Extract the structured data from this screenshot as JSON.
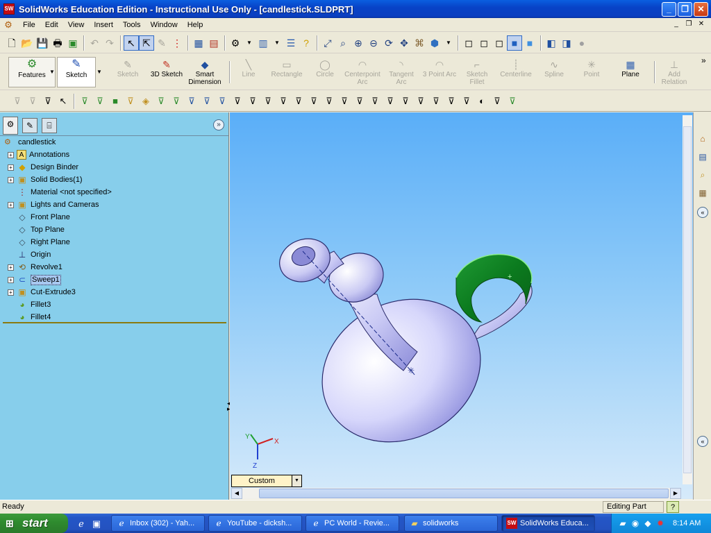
{
  "window": {
    "app_icon": "SW",
    "title": "SolidWorks Education Edition - Instructional Use Only - [candlestick.SLDPRT]",
    "buttons": {
      "minimize": "_",
      "restore": "❐",
      "close": "✕"
    }
  },
  "menu": {
    "items": [
      "File",
      "Edit",
      "View",
      "Insert",
      "Tools",
      "Window",
      "Help"
    ],
    "mdi_buttons": [
      "_",
      "❐",
      "✕"
    ]
  },
  "toolbar_standard": {
    "icons": [
      "new-icon",
      "open-icon",
      "save-icon",
      "print-icon",
      "print-preview-icon",
      "undo-icon",
      "redo-icon",
      "select-icon",
      "select-filter-icon",
      "sketch-rebuild-icon",
      "rebuild-traffic-light-icon",
      "grid-icon",
      "wall-icon",
      "options-icon",
      "layer-icon",
      "properties-icon",
      "help-icon",
      "zoom-to-fit-icon",
      "zoom-area-icon",
      "zoom-in-out-icon",
      "zoom-selection-icon",
      "rotate-icon",
      "pan-icon",
      "view-orientation-icon",
      "wireframe-icon",
      "hidden-lines-visible-icon",
      "hidden-lines-removed-icon",
      "shaded-with-edges-icon",
      "shaded-icon",
      "section-view-icon",
      "perspective-icon"
    ]
  },
  "command_manager": {
    "features_label": "Features",
    "sketch_label": "Sketch",
    "items": [
      {
        "label": "Sketch",
        "icon": "sketch-icon"
      },
      {
        "label": "3D Sketch",
        "icon": "3d-sketch-icon"
      },
      {
        "label": "Smart Dimension",
        "icon": "smart-dimension-icon"
      },
      {
        "label": "Line",
        "icon": "line-icon"
      },
      {
        "label": "Rectangle",
        "icon": "rectangle-icon"
      },
      {
        "label": "Circle",
        "icon": "circle-icon"
      },
      {
        "label": "Centerpoint Arc",
        "icon": "centerpoint-arc-icon"
      },
      {
        "label": "Tangent Arc",
        "icon": "tangent-arc-icon"
      },
      {
        "label": "3 Point Arc",
        "icon": "three-point-arc-icon"
      },
      {
        "label": "Sketch Fillet",
        "icon": "sketch-fillet-icon"
      },
      {
        "label": "Centerline",
        "icon": "centerline-icon"
      },
      {
        "label": "Spline",
        "icon": "spline-icon"
      },
      {
        "label": "Point",
        "icon": "point-icon"
      },
      {
        "label": "Plane",
        "icon": "plane-icon"
      },
      {
        "label": "Add Relation",
        "icon": "add-relation-icon"
      }
    ],
    "more": "»"
  },
  "feature_manager": {
    "tabs": [
      "feature-tree-icon",
      "property-manager-icon",
      "configuration-manager-icon"
    ],
    "root": "candlestick",
    "items": [
      {
        "label": "Annotations",
        "expand": "+"
      },
      {
        "label": "Design Binder",
        "expand": "+"
      },
      {
        "label": "Solid Bodies(1)",
        "expand": "+"
      },
      {
        "label": "Material <not specified>",
        "expand": ""
      },
      {
        "label": "Lights and Cameras",
        "expand": "+"
      },
      {
        "label": "Front Plane",
        "expand": ""
      },
      {
        "label": "Top Plane",
        "expand": ""
      },
      {
        "label": "Right Plane",
        "expand": ""
      },
      {
        "label": "Origin",
        "expand": ""
      },
      {
        "label": "Revolve1",
        "expand": "+"
      },
      {
        "label": "Sweep1",
        "expand": "+"
      },
      {
        "label": "Cut-Extrude3",
        "expand": "+"
      },
      {
        "label": "Fillet3",
        "expand": ""
      },
      {
        "label": "Fillet4",
        "expand": ""
      }
    ],
    "selected_index": 10
  },
  "graphics": {
    "triad": {
      "x": "X",
      "y": "Y",
      "z": "Z"
    },
    "view_select": "Custom"
  },
  "task_pane": {
    "icons": [
      "home-icon",
      "design-library-icon",
      "file-explorer-icon",
      "palette-icon"
    ]
  },
  "status": {
    "left": "Ready",
    "mode": "Editing Part",
    "help": "?"
  },
  "taskbar": {
    "start": "start",
    "tasks": [
      {
        "label": "Inbox (302) - Yah...",
        "icon": "browser-icon"
      },
      {
        "label": "YouTube - dicksh...",
        "icon": "browser-icon"
      },
      {
        "label": "PC World - Revie...",
        "icon": "browser-icon"
      },
      {
        "label": "solidworks",
        "icon": "folder-icon"
      },
      {
        "label": "SolidWorks Educa...",
        "icon": "solidworks-icon"
      }
    ],
    "clock": "8:14 AM"
  }
}
